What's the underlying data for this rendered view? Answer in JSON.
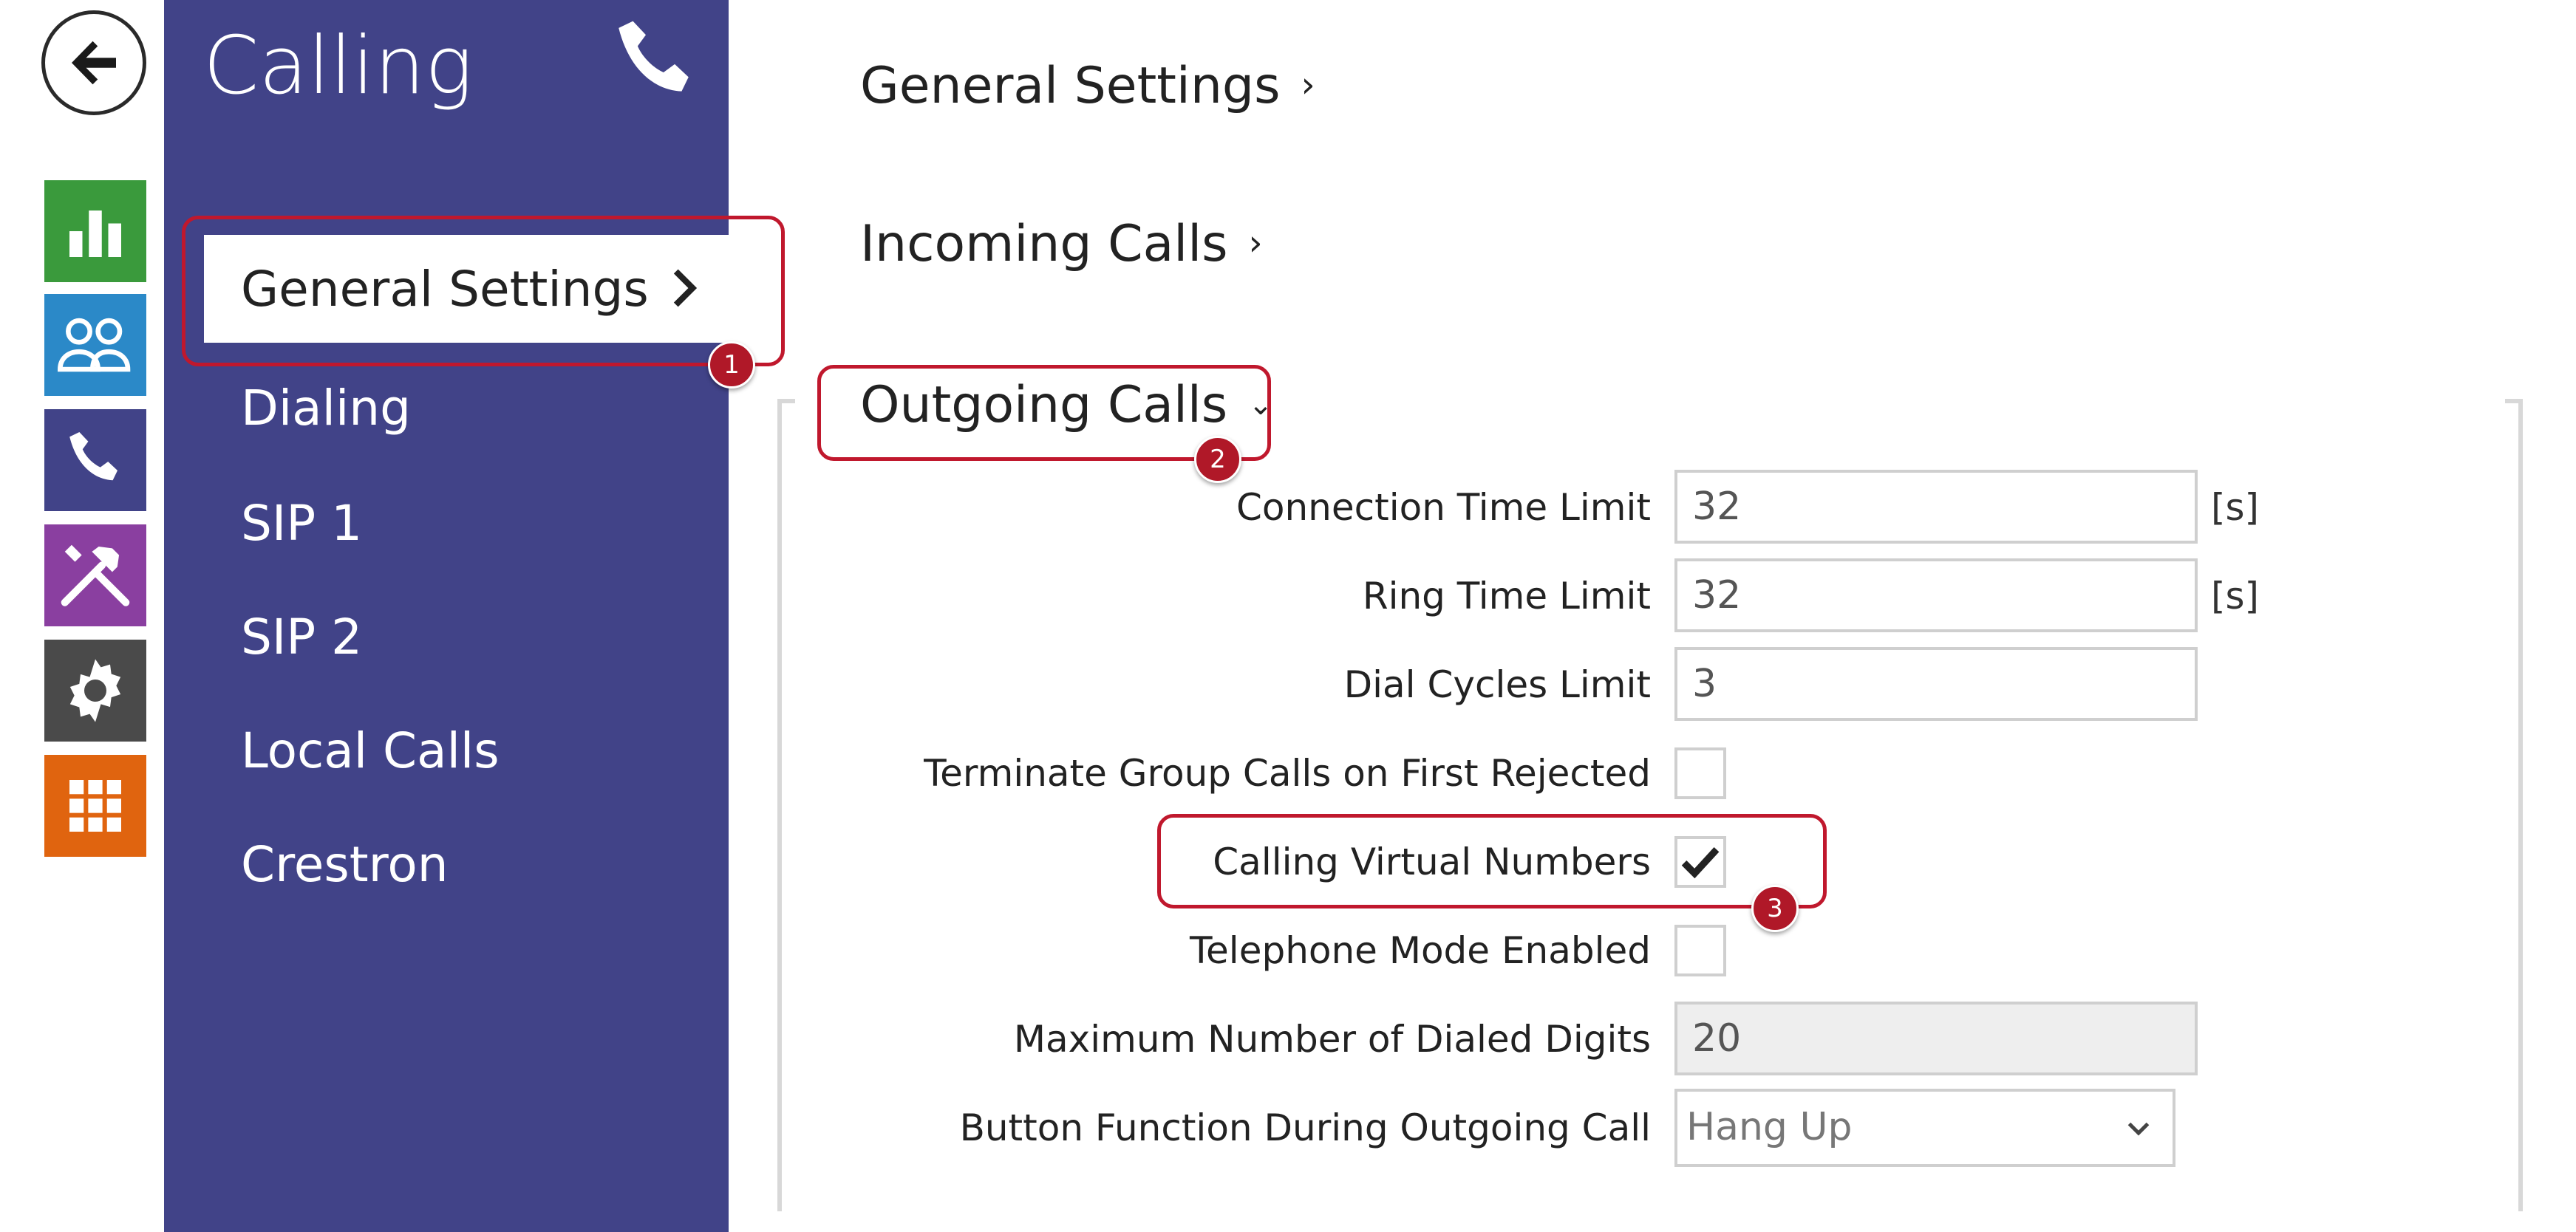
{
  "rail": {
    "back_icon": "arrow-left-icon",
    "items": [
      {
        "icon": "bar-chart-icon",
        "color": "#3a9a3c"
      },
      {
        "icon": "users-icon",
        "color": "#2b89c8"
      },
      {
        "icon": "phone-icon",
        "color": "#414388"
      },
      {
        "icon": "tools-icon",
        "color": "#8a3fa0"
      },
      {
        "icon": "gear-icon",
        "color": "#4a4a4a"
      },
      {
        "icon": "grid-icon",
        "color": "#e0640f"
      }
    ]
  },
  "sidebar": {
    "title": "Calling",
    "color": "#414388",
    "active_item": "General Settings",
    "items": [
      "Dialing",
      "SIP 1",
      "SIP 2",
      "Local Calls",
      "Crestron"
    ]
  },
  "main": {
    "sections": [
      {
        "label": "General Settings",
        "expanded": false
      },
      {
        "label": "Incoming Calls",
        "expanded": false
      },
      {
        "label": "Outgoing Calls",
        "expanded": true
      }
    ],
    "fields": {
      "connection_time_limit": {
        "label": "Connection Time Limit",
        "value": "32",
        "unit": "[s]"
      },
      "ring_time_limit": {
        "label": "Ring Time Limit",
        "value": "32",
        "unit": "[s]"
      },
      "dial_cycles_limit": {
        "label": "Dial Cycles Limit",
        "value": "3"
      },
      "terminate_group_calls": {
        "label": "Terminate Group Calls on First Rejected",
        "checked": false
      },
      "calling_virtual_numbers": {
        "label": "Calling Virtual Numbers",
        "checked": true
      },
      "telephone_mode_enabled": {
        "label": "Telephone Mode Enabled",
        "checked": false
      },
      "max_dialed_digits": {
        "label": "Maximum Number of Dialed Digits",
        "value": "20",
        "disabled": true
      },
      "button_function": {
        "label": "Button Function During Outgoing Call",
        "value": "Hang Up"
      }
    }
  },
  "annotations": {
    "accent": "#c0182d",
    "badges": [
      "1",
      "2",
      "3"
    ]
  }
}
